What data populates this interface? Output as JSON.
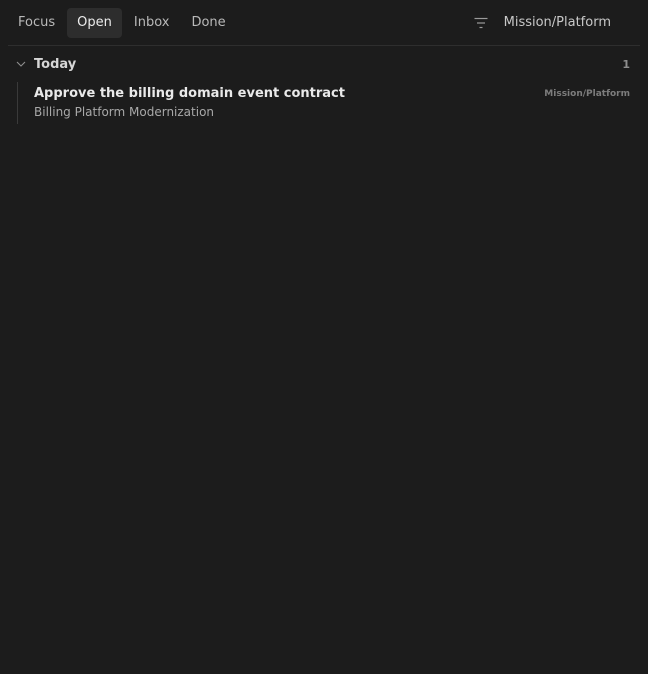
{
  "tabs": [
    {
      "label": "Focus",
      "active": false
    },
    {
      "label": "Open",
      "active": true
    },
    {
      "label": "Inbox",
      "active": false
    },
    {
      "label": "Done",
      "active": false
    }
  ],
  "header": {
    "filter_icon": "filter-icon",
    "scope_label": "Mission/Platform"
  },
  "group": {
    "title": "Today",
    "count": "1",
    "chevron_icon": "chevron-down-icon"
  },
  "tasks": [
    {
      "title": "Approve the billing domain event contract",
      "project": "Billing Platform Modernization",
      "tag": "Mission/Platform"
    }
  ],
  "colors": {
    "background": "#1c1c1c",
    "active_tab": "#2d2d2d",
    "divider": "#2e2e2e"
  }
}
